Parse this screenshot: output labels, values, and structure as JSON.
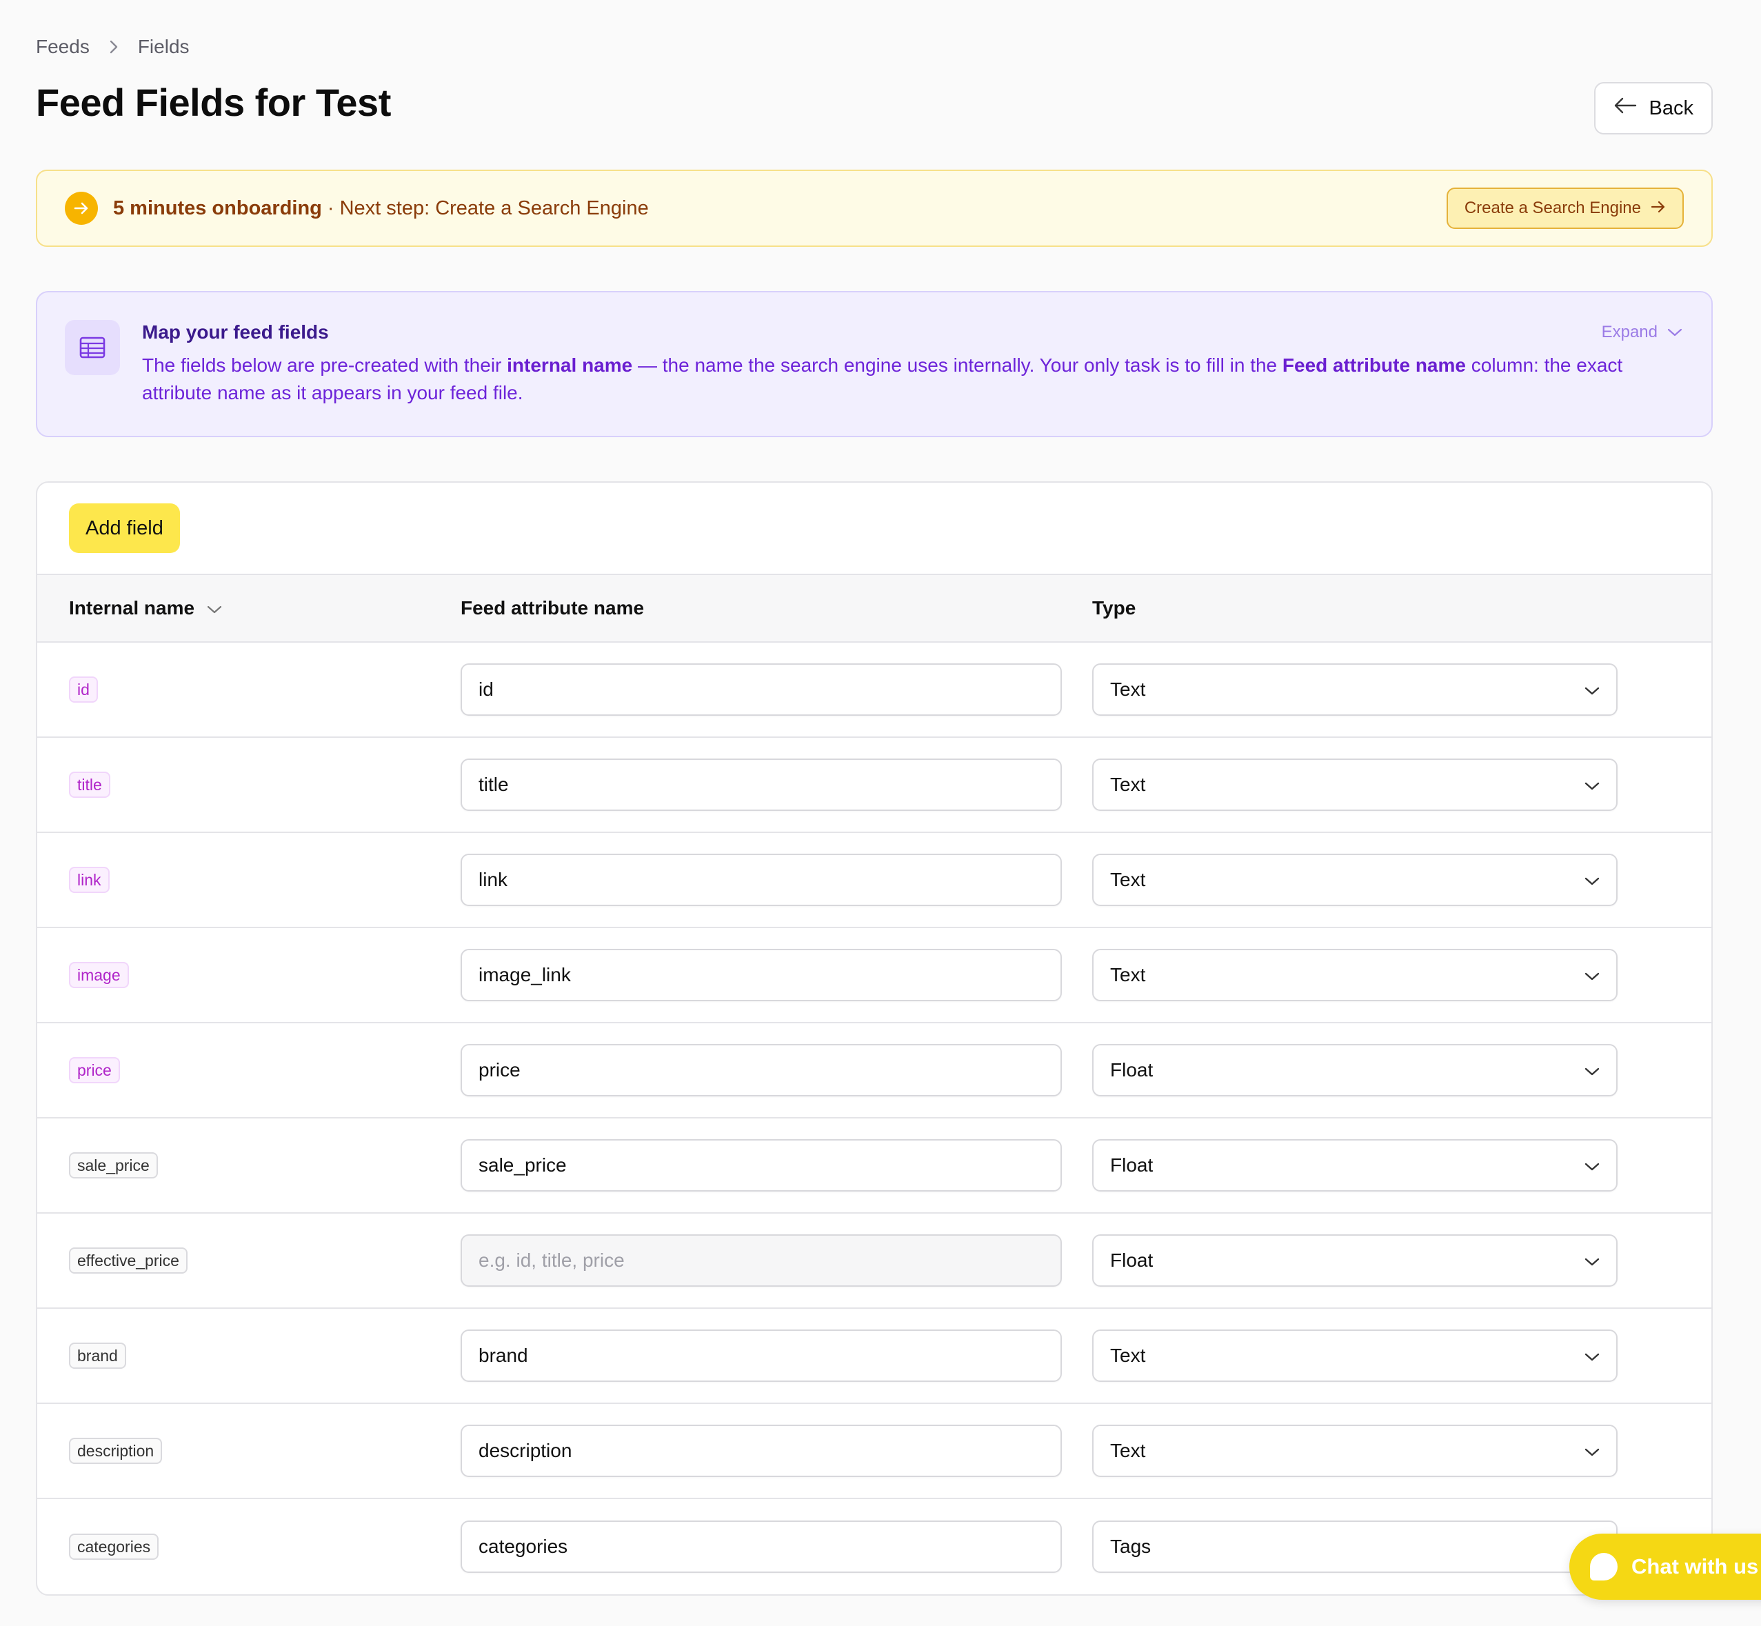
{
  "breadcrumb": {
    "items": [
      "Feeds",
      "Fields"
    ]
  },
  "header": {
    "title": "Feed Fields for Test",
    "back_label": "Back"
  },
  "onboarding": {
    "strong": "5 minutes onboarding",
    "separator": "·",
    "text": "Next step: Create a Search Engine",
    "button_label": "Create a Search Engine",
    "accent_color": "#f7b400"
  },
  "info": {
    "title": "Map your feed fields",
    "text_1": "The fields below are pre-created with their ",
    "bold_1": "internal name",
    "text_2": " — the name the search engine uses internally. Your only task is to fill in the ",
    "bold_2": "Feed attribute name",
    "text_3": " column: the exact attribute name as it appears in your feed file.",
    "expand_label": "Expand",
    "icon": "table-icon"
  },
  "table": {
    "add_label": "Add field",
    "headers": {
      "internal": "Internal name",
      "feed": "Feed attribute name",
      "type": "Type"
    },
    "rows": [
      {
        "internal": "id",
        "feed": "id",
        "placeholder": "",
        "type": "Text",
        "required": true
      },
      {
        "internal": "title",
        "feed": "title",
        "placeholder": "",
        "type": "Text",
        "required": true
      },
      {
        "internal": "link",
        "feed": "link",
        "placeholder": "",
        "type": "Text",
        "required": true
      },
      {
        "internal": "image",
        "feed": "image_link",
        "placeholder": "",
        "type": "Text",
        "required": true
      },
      {
        "internal": "price",
        "feed": "price",
        "placeholder": "",
        "type": "Float",
        "required": true
      },
      {
        "internal": "sale_price",
        "feed": "sale_price",
        "placeholder": "",
        "type": "Float",
        "required": false
      },
      {
        "internal": "effective_price",
        "feed": "",
        "placeholder": "e.g. id, title, price",
        "type": "Float",
        "required": false
      },
      {
        "internal": "brand",
        "feed": "brand",
        "placeholder": "",
        "type": "Text",
        "required": false
      },
      {
        "internal": "description",
        "feed": "description",
        "placeholder": "",
        "type": "Text",
        "required": false
      },
      {
        "internal": "categories",
        "feed": "categories",
        "placeholder": "",
        "type": "Tags",
        "required": false
      }
    ]
  },
  "chat": {
    "label": "Chat with us",
    "color": "#f5d814"
  }
}
